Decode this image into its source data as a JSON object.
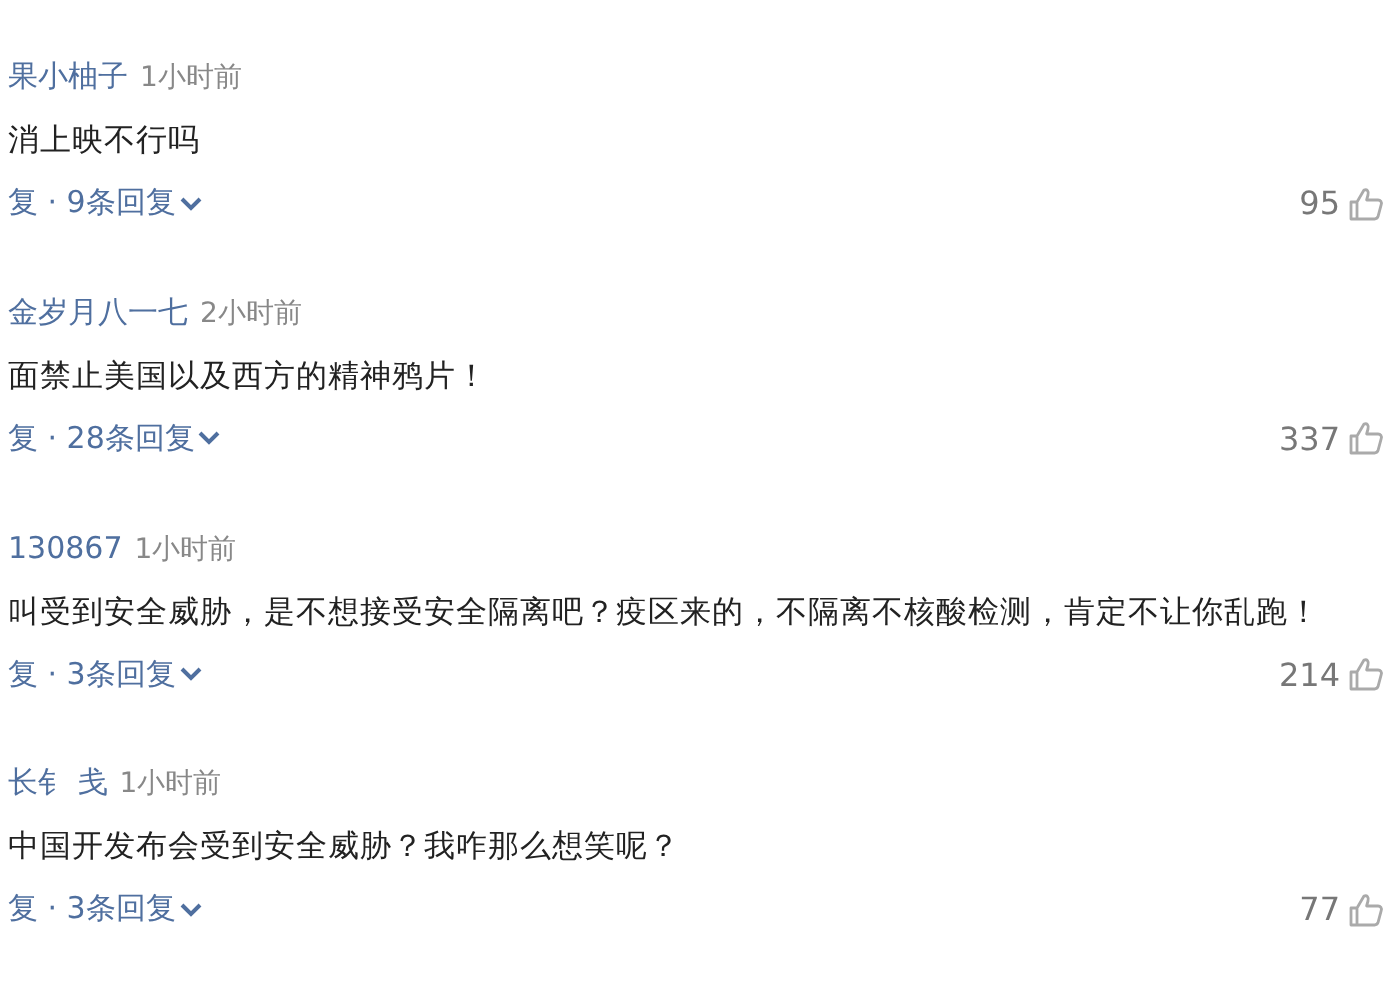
{
  "comments": [
    {
      "user": "果小柚子",
      "time": "1小时前",
      "text": "消上映不行吗",
      "reply": "复 · 9条回复",
      "likes": "95"
    },
    {
      "user": "金岁月八一七",
      "time": "2小时前",
      "text": "面禁止美国以及西方的精神鸦片！",
      "reply": "复 · 28条回复",
      "likes": "337"
    },
    {
      "user": "130867",
      "time": "1小时前",
      "text": "叫受到安全威胁，是不想接受安全隔离吧？疫区来的，不隔离不核酸检测，肯定不让你乱跑！",
      "reply": "复 · 3条回复",
      "likes": "214"
    },
    {
      "user": "长钅 戋",
      "time": "1小时前",
      "text": "中国开发布会受到安全威胁？我咋那么想笑呢？",
      "reply": "复 · 3条回复",
      "likes": "77"
    }
  ]
}
